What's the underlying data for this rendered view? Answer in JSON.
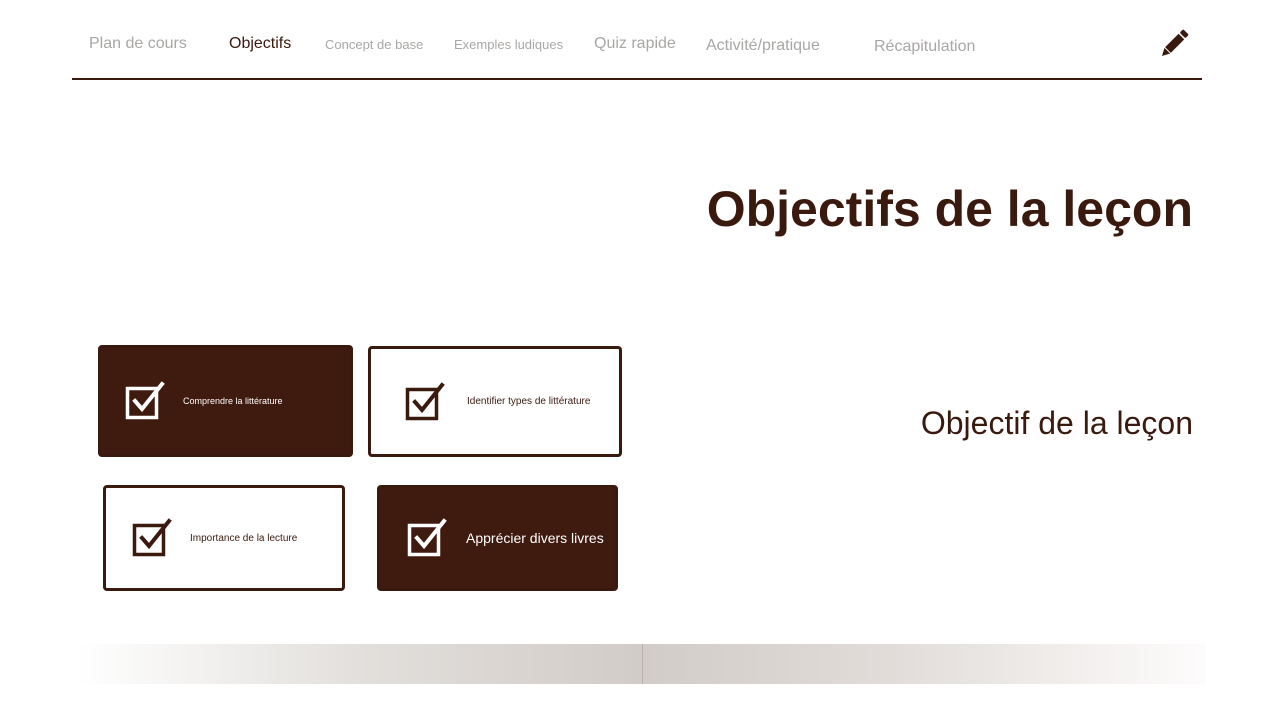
{
  "nav": {
    "tabs": [
      {
        "label": "Plan de cours"
      },
      {
        "label": "Objectifs"
      },
      {
        "label": "Concept de base"
      },
      {
        "label": "Exemples ludiques"
      },
      {
        "label": "Quiz rapide"
      },
      {
        "label": "Activité/pratique"
      },
      {
        "label": "Récapitulation"
      }
    ],
    "active_tab": "Objectifs",
    "edit_icon": "pencil-icon"
  },
  "main": {
    "title": "Objectifs de la leçon",
    "subtitle": "Objectif de la leçon",
    "objectives": [
      {
        "label": "Comprendre la littérature",
        "style": "dark",
        "icon": "checkbox-checked-icon"
      },
      {
        "label": "Identifier types de littérature",
        "style": "light",
        "icon": "checkbox-checked-icon"
      },
      {
        "label": "Importance de la lecture",
        "style": "light",
        "icon": "checkbox-checked-icon"
      },
      {
        "label": "Apprécier divers livres",
        "style": "dark",
        "icon": "checkbox-checked-icon"
      }
    ]
  },
  "colors": {
    "brand_brown": "#3f1a0f",
    "text_dark": "#3a1a0f",
    "tab_inactive": "#a9a7a5",
    "card_light_bg": "#ffffff"
  }
}
